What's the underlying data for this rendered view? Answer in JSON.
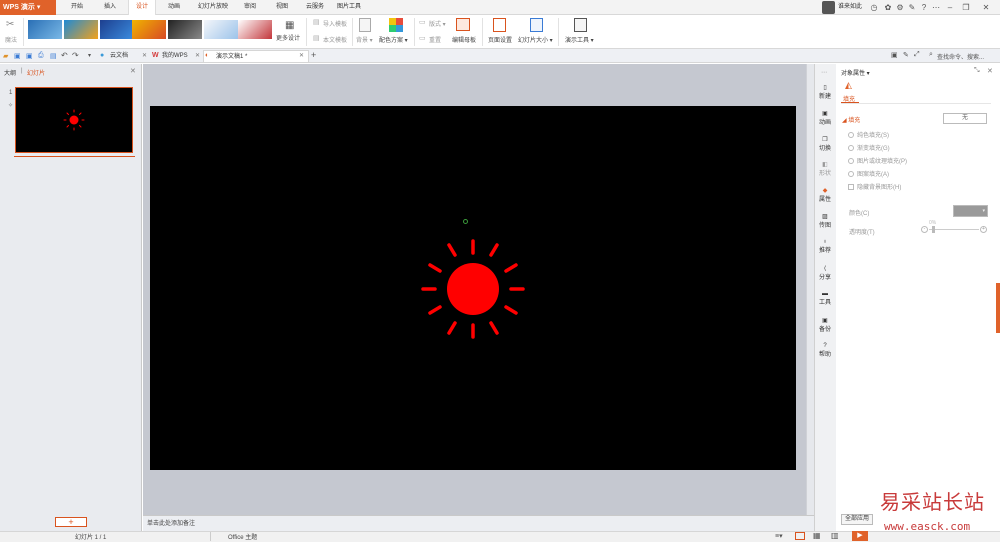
{
  "app": {
    "name": "WPS 演示"
  },
  "menu": [
    "开始",
    "插入",
    "设计",
    "动画",
    "幻灯片放映",
    "审阅",
    "视图",
    "云服务",
    "图片工具"
  ],
  "user": {
    "name": "谁来如此"
  },
  "ribbon": {
    "magic": "魔法",
    "more_designs": "更多设计",
    "import_template": "导入模板",
    "this_template": "本文模板",
    "background": "背景",
    "color_scheme": "配色方案",
    "layout": "版式",
    "reset": "重置",
    "edit_master": "编辑母板",
    "page_setup": "页面设置",
    "slide_size": "幻灯片大小",
    "presentation_tools": "演示工具"
  },
  "qbar": {
    "tabs": [
      "云文档",
      "我的WPS",
      "演示文稿1 *"
    ],
    "search": "查找命令、搜索..."
  },
  "left_panel": {
    "tabs": [
      "大纲",
      "幻灯片"
    ],
    "slide_number": "1",
    "add_label": "+"
  },
  "notes_placeholder": "单击此处添加备注",
  "vstrip": [
    "新建",
    "动画",
    "切换",
    "形状",
    "属性",
    "传图",
    "推荐",
    "分享",
    "工具",
    "备份",
    "帮助"
  ],
  "right_panel": {
    "title": "对象属性",
    "tab_fill": "填充",
    "section_fill": "填充",
    "none_button": "无",
    "options": [
      "纯色填充(S)",
      "渐变填充(G)",
      "图片或纹理填充(P)",
      "图案填充(A)"
    ],
    "hide_bg": "隐藏背景图形(H)",
    "color_label": "颜色(C)",
    "transparency_label": "透明度(T)",
    "transparency_value": "0%",
    "apply_all": "全部应用"
  },
  "status": {
    "slide_info": "幻灯片 1 / 1",
    "theme": "Office 主题"
  },
  "watermark": {
    "cn": "易采站长站",
    "url": "www.easck.com"
  },
  "colors": {
    "accent": "#d9531e",
    "sun": "#ff0000"
  }
}
